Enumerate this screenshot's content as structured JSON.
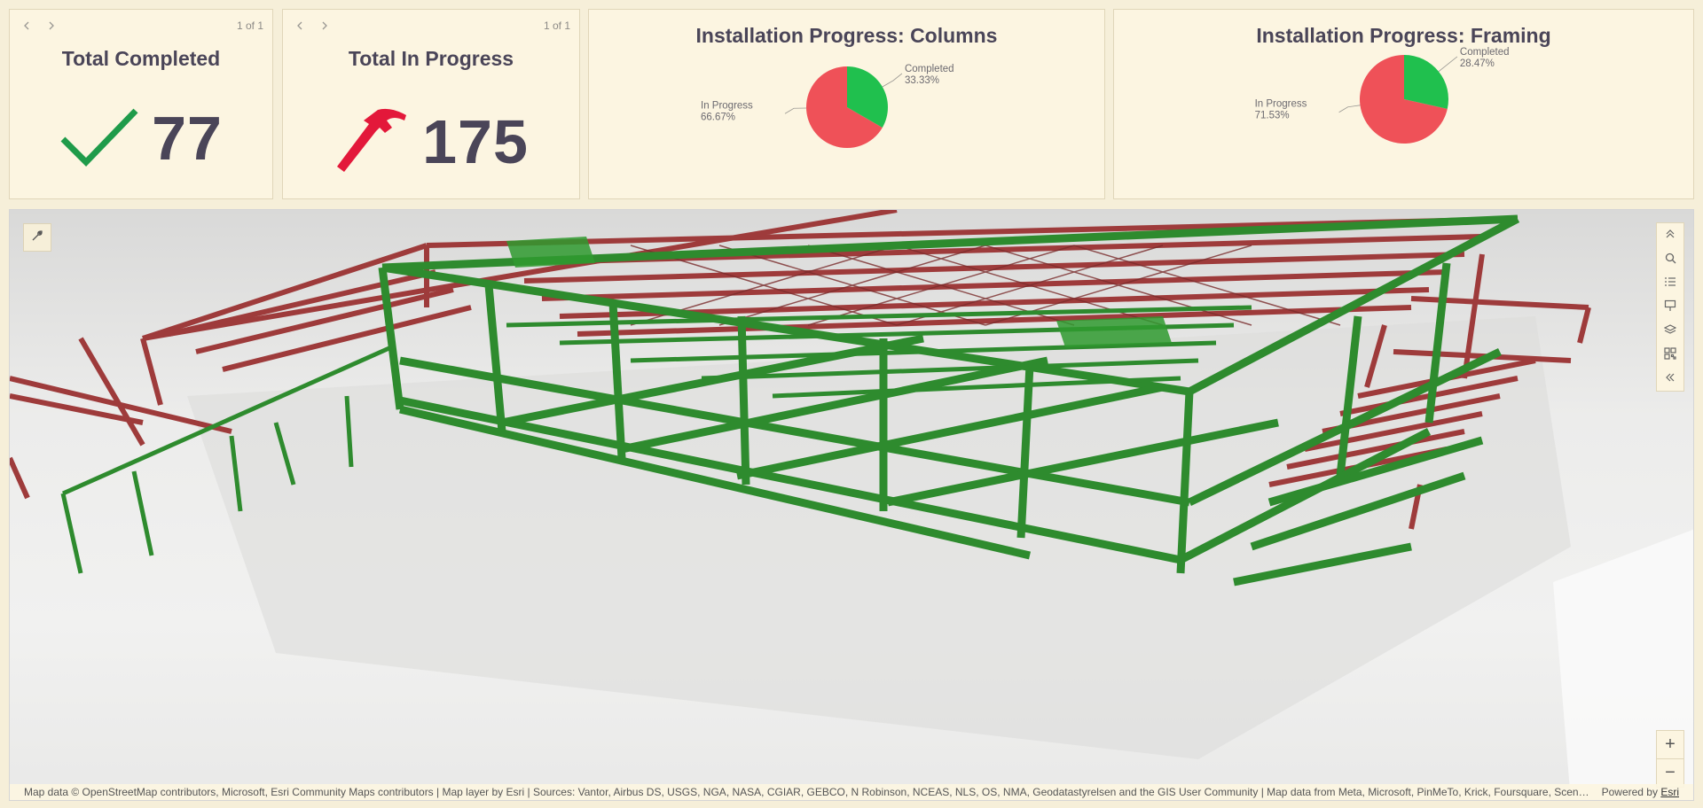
{
  "cards": {
    "completed": {
      "title": "Total Completed",
      "value": "77",
      "page": "1 of 1",
      "icon": "checkmark-icon",
      "icon_color": "#1f9b4a"
    },
    "in_progress": {
      "title": "Total In Progress",
      "value": "175",
      "page": "1 of 1",
      "icon": "hammer-icon",
      "icon_color": "#e3183a"
    }
  },
  "chart_data": [
    {
      "type": "pie",
      "title": "Installation Progress: Columns",
      "categories": [
        "Completed",
        "In Progress"
      ],
      "values": [
        33.33,
        66.67
      ],
      "labels": [
        "33.33%",
        "66.67%"
      ],
      "colors": [
        "#20c04e",
        "#ef5158"
      ]
    },
    {
      "type": "pie",
      "title": "Installation Progress: Framing",
      "categories": [
        "Completed",
        "In Progress"
      ],
      "values": [
        28.47,
        71.53
      ],
      "labels": [
        "28.47%",
        "71.53%"
      ],
      "colors": [
        "#20c04e",
        "#ef5158"
      ]
    }
  ],
  "map": {
    "toolbar": [
      "collapse-icon",
      "search-icon",
      "legend-icon",
      "presentation-icon",
      "layers-icon",
      "qr-code-icon",
      "expand-icon"
    ],
    "zoom_in": "+",
    "zoom_out": "−",
    "attribution": "Map data © OpenStreetMap contributors, Microsoft, Esri Community Maps contributors | Map layer by Esri | Sources: Vantor, Airbus DS, USGS, NGA, NASA, CGIAR, GEBCO, N Robinson, NCEAS, NLS, OS, NMA, Geodatastyrelsen and the GIS User Community | Map data from Meta, Microsoft, PinMeTo, Krick, Foursquare, Scene la...",
    "powered_by": "Powered by",
    "powered_link": "Esri",
    "colors": {
      "completed": "#2e8b2e",
      "in_progress": "#9e3b3b"
    }
  }
}
